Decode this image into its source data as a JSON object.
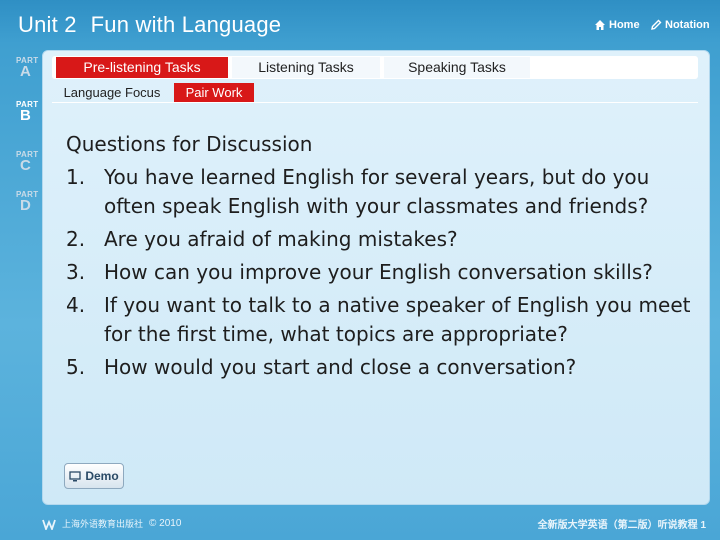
{
  "header": {
    "unit": "Unit 2",
    "title": "Fun with Language",
    "home_label": "Home",
    "notation_label": "Notation"
  },
  "parts": [
    {
      "label": "PART",
      "letter": "A",
      "active": false
    },
    {
      "label": "PART",
      "letter": "B",
      "active": true
    },
    {
      "label": "PART",
      "letter": "C",
      "active": false
    },
    {
      "label": "PART",
      "letter": "D",
      "active": false
    }
  ],
  "tabs": [
    {
      "label": "Pre-listening Tasks",
      "active": true
    },
    {
      "label": "Listening Tasks",
      "active": false
    },
    {
      "label": "Speaking Tasks",
      "active": false
    }
  ],
  "subtabs": [
    {
      "label": "Language Focus",
      "active": false
    },
    {
      "label": "Pair Work",
      "active": true
    }
  ],
  "content": {
    "heading": "Questions for Discussion",
    "questions": [
      {
        "num": "1.",
        "text": "You have learned English for several years, but do you often speak English with your classmates and friends?"
      },
      {
        "num": "2.",
        "text": "Are you afraid of making mistakes?"
      },
      {
        "num": "3.",
        "text": "How can you improve your English conversation skills?"
      },
      {
        "num": "4.",
        "text": "If you want to talk to a native speaker of English you meet for the first time, what topics are appropriate?"
      },
      {
        "num": "5.",
        "text": "How would you start and close a conversation?"
      }
    ]
  },
  "demo_label": "Demo",
  "footer": {
    "publisher": "上海外语教育出版社",
    "copyright": "© 2010",
    "book": "全新版大学英语（第二版）听说教程",
    "page": "1"
  },
  "colors": {
    "accent": "#d81818",
    "background": "#3f9fd0",
    "panel": "#dff1fb"
  }
}
